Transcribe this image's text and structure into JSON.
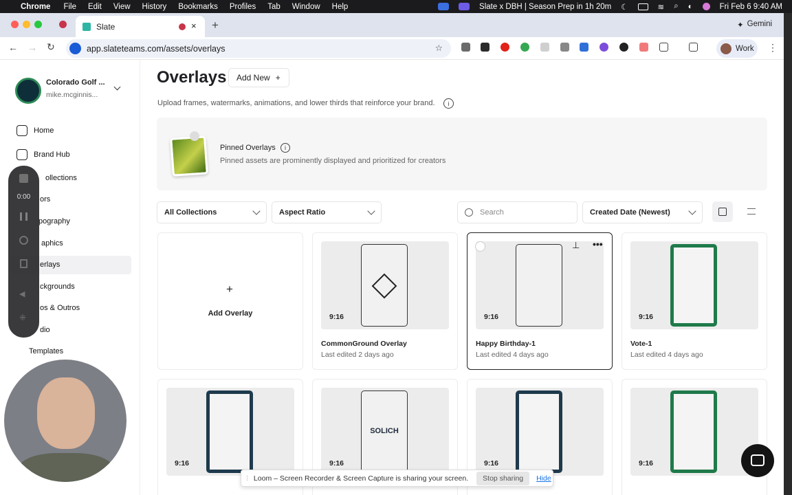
{
  "menubar": {
    "app": "Chrome",
    "items": [
      "File",
      "Edit",
      "View",
      "History",
      "Bookmarks",
      "Profiles",
      "Tab",
      "Window",
      "Help"
    ],
    "meeting": "Slate x DBH | Season Prep in 1h 20m",
    "datetime": "Fri Feb 6  9:40 AM"
  },
  "browser": {
    "tab_title": "Slate",
    "url": "app.slateteams.com/assets/overlays",
    "gemini": "Gemini",
    "profile": "Work"
  },
  "sidebar": {
    "org_name": "Colorado Golf ...",
    "user_email": "mike.mcginnis...",
    "items": [
      {
        "label": "Home"
      },
      {
        "label": "Brand Hub"
      },
      {
        "label": "ollections"
      },
      {
        "label": "ors"
      },
      {
        "label": "pography"
      },
      {
        "label": "aphics"
      },
      {
        "label": "erlays"
      },
      {
        "label": "ckgrounds"
      },
      {
        "label": "os & Outros"
      },
      {
        "label": "dio"
      },
      {
        "label": "Templates"
      }
    ]
  },
  "header": {
    "title": "Overlays",
    "add_new": "Add New",
    "subtitle": "Upload frames, watermarks, animations, and lower thirds that reinforce your brand."
  },
  "pinned": {
    "title": "Pinned Overlays",
    "subtitle": "Pinned assets are prominently displayed and prioritized for creators"
  },
  "filters": {
    "collections": "All Collections",
    "aspect": "Aspect Ratio",
    "search_placeholder": "Search",
    "sort": "Created Date (Newest)"
  },
  "add_card": {
    "label": "Add Overlay"
  },
  "cards": [
    {
      "ratio": "9:16",
      "title": "CommonGround Overlay",
      "edited": "Last edited 2 days ago"
    },
    {
      "ratio": "9:16",
      "title": "Happy Birthday-1",
      "edited": "Last edited 4 days ago"
    },
    {
      "ratio": "9:16",
      "title": "Vote-1",
      "edited": "Last edited 4 days ago"
    },
    {
      "ratio": "9:16"
    },
    {
      "ratio": "9:16",
      "logo": "SOLICH"
    },
    {
      "ratio": "9:16"
    },
    {
      "ratio": "9:16"
    }
  ],
  "loom": {
    "timer": "0:00",
    "share_text": "Loom – Screen Recorder & Screen Capture is sharing your screen.",
    "stop": "Stop sharing",
    "hide": "Hide"
  },
  "colors": {
    "accent": "#1a73e8",
    "frame_green": "#1f7a4a",
    "frame_navy": "#1e3a4c"
  }
}
